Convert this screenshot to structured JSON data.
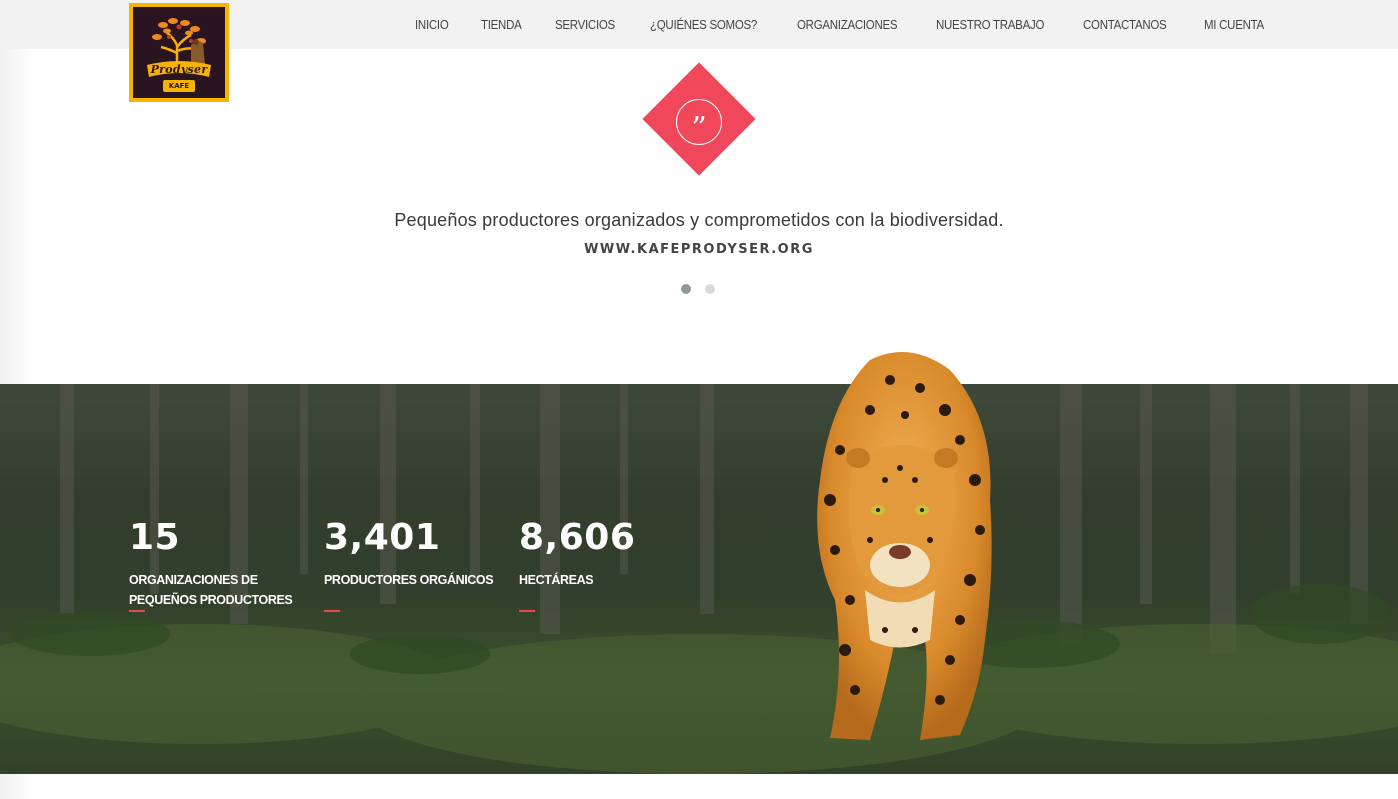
{
  "brand": {
    "name": "Prodyser",
    "sub": "KAFE"
  },
  "nav": [
    "INICIO",
    "TIENDA",
    "SERVICIOS",
    "¿QUIÉNES SOMOS?",
    "ORGANIZACIONES",
    "NUESTRO TRABAJO",
    "CONTACTANOS",
    "MI CUENTA"
  ],
  "testimonial": {
    "text": "Pequeños productores organizados y comprometidos con la biodiversidad.",
    "source": "WWW.KAFEPRODYSER.ORG",
    "slides": 2,
    "active_slide": 1
  },
  "stats": [
    {
      "value": "15",
      "label": "ORGANIZACIONES DE PEQUEÑOS PRODUCTORES"
    },
    {
      "value": "3,401",
      "label": "PRODUCTORES ORGÁNICOS"
    },
    {
      "value": "8,606",
      "label": "HECTÁREAS"
    }
  ],
  "colors": {
    "accent": "#f0475b",
    "logo_gold": "#f6b400",
    "rule_red": "#e84a4a"
  }
}
